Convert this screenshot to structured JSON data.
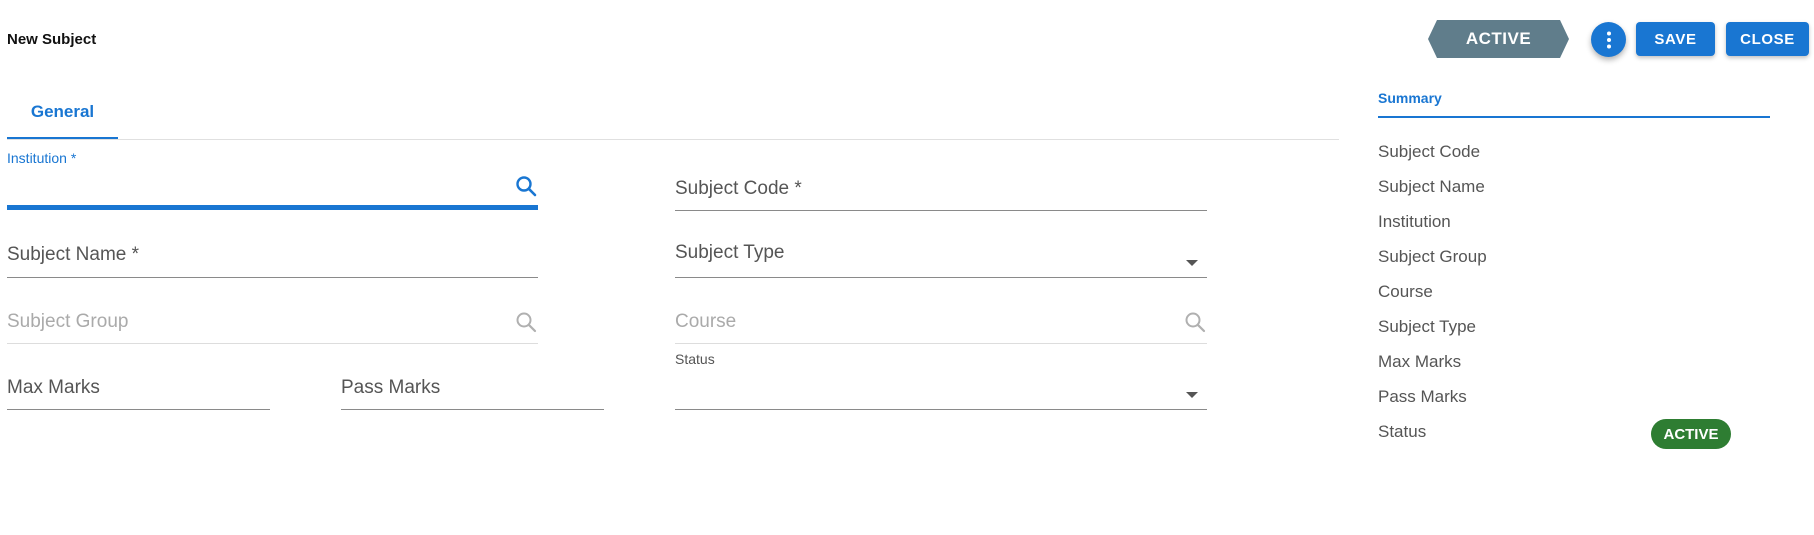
{
  "header": {
    "title": "New Subject",
    "status_label": "ACTIVE",
    "more_icon": "more-vertical-icon",
    "save_label": "SAVE",
    "close_label": "CLOSE"
  },
  "tabs": [
    {
      "label": "General",
      "active": true
    }
  ],
  "form": {
    "institution": {
      "label": "Institution *",
      "value": "",
      "icon": "search-icon"
    },
    "subject_code": {
      "label": "Subject Code *",
      "value": ""
    },
    "subject_name": {
      "label": "Subject Name *",
      "value": ""
    },
    "subject_type": {
      "label": "Subject Type",
      "value": "",
      "icon": "caret-down-icon"
    },
    "subject_group": {
      "label": "Subject Group",
      "value": "",
      "icon": "search-icon"
    },
    "course": {
      "label": "Course",
      "value": "",
      "icon": "search-icon"
    },
    "max_marks": {
      "label": "Max Marks",
      "value": ""
    },
    "pass_marks": {
      "label": "Pass Marks",
      "value": ""
    },
    "status": {
      "label": "Status",
      "value": "",
      "icon": "caret-down-icon"
    }
  },
  "summary": {
    "title": "Summary",
    "items": [
      "Subject Code",
      "Subject Name",
      "Institution",
      "Subject Group",
      "Course",
      "Subject Type",
      "Max Marks",
      "Pass Marks",
      "Status"
    ],
    "status_chip": "ACTIVE"
  },
  "colors": {
    "primary": "#1976d2",
    "ribbon": "#607d8b",
    "active_chip": "#2e7d32"
  }
}
